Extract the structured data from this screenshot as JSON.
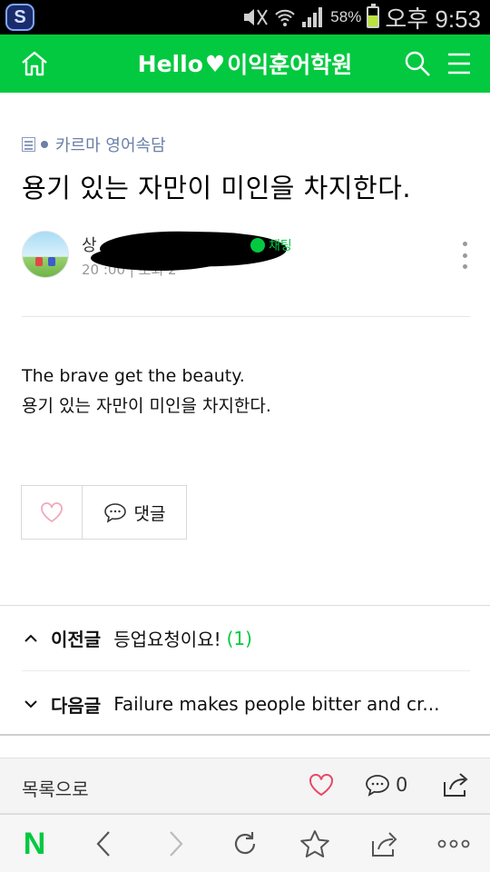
{
  "status_bar": {
    "battery_percent": "58%",
    "battery_level": 0.58,
    "time": "오후 9:53",
    "app_icon": "s-icon"
  },
  "header": {
    "title_prefix": "Hello",
    "title_suffix": "이익훈어학원",
    "heart_glyph": "♥",
    "home_icon": "home-icon",
    "search_icon": "search-icon",
    "menu_icon": "menu-icon",
    "bg_color": "#03c940"
  },
  "article": {
    "category": "카르마 영어속담",
    "title": "용기 있는 자만이 미인을 차지한다.",
    "author_name": "상",
    "author_meta": "20            :00  |  조회 2",
    "chat_label": "채팅",
    "body_line1": "The brave get the beauty.",
    "body_line2": "용기 있는 자만이 미인을 차지한다."
  },
  "actions": {
    "comment_label": "댓글"
  },
  "navigation": {
    "prev_label": "이전글",
    "prev_title": "등업요청이요!",
    "prev_count": "(1)",
    "next_label": "다음글",
    "next_title": "Failure makes people bitter and cr..."
  },
  "footer": {
    "list_label": "목록으로",
    "comment_count": "0"
  },
  "browser_bar": {
    "logo": "N"
  },
  "colors": {
    "accent": "#03c940",
    "heart_pink": "#e8486a",
    "category_blue": "#6b7fa8"
  }
}
